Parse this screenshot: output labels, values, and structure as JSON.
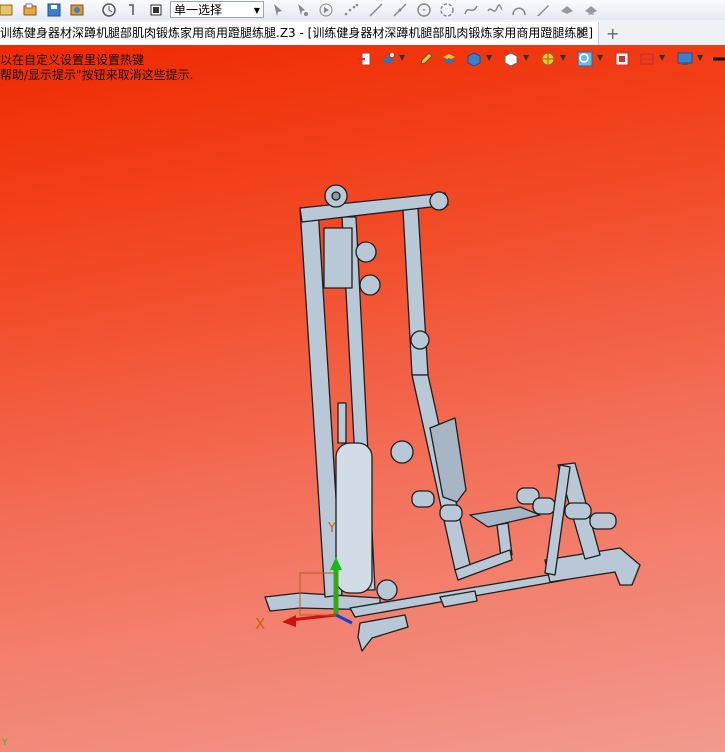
{
  "toolbar": {
    "selection_mode": "单一选择",
    "icons": [
      "new-icon",
      "open-icon",
      "save-icon",
      "import-icon",
      "clock-icon",
      "help-icon",
      "record-icon",
      "pick-icon",
      "pick-point-icon",
      "play-icon",
      "points-icon",
      "line-icon",
      "diagonal-icon",
      "circle-icon",
      "arc-icon",
      "spline-icon",
      "wave-icon",
      "bridge-icon",
      "knife-icon",
      "lamp-icon",
      "lamp2-icon"
    ]
  },
  "tab": {
    "title": "训练健身器材深蹲机腿部肌肉锻炼家用商用蹬腿练腿.Z3 - [训练健身器材深蹲机腿部肌肉锻炼家用商用蹬腿练腿]",
    "close": "✕",
    "add": "+"
  },
  "viewport": {
    "hint_line1": "以在自定义设置里设置热键",
    "hint_line2": "帮助/显示提示\"按钮来取消这些提示.",
    "axis_x": "X",
    "axis_y": "Y",
    "corner_label": "Y"
  },
  "colors": {
    "bg_top": "#f02a00",
    "bg_bottom": "#f29a8e",
    "model": "#b6c5d3",
    "model_outline": "#222222"
  }
}
